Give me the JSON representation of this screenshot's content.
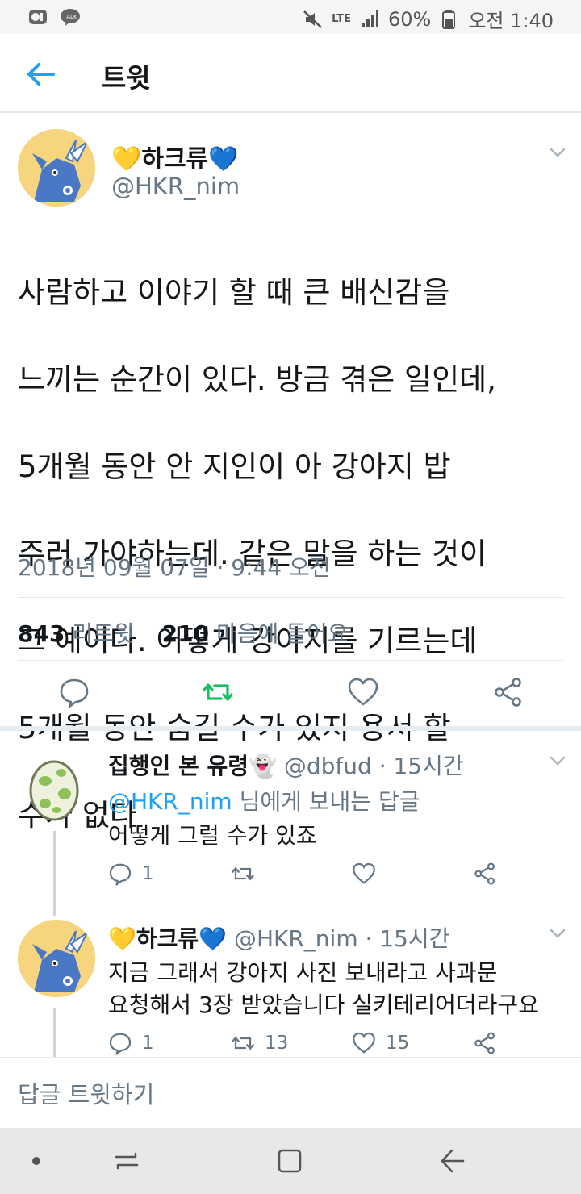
{
  "status_bar": {
    "left_icons": [
      "uplus-icon",
      "kakaotalk-icon"
    ],
    "kakao_label": "TALK",
    "network": "LTE",
    "battery": "60%",
    "time": "오전 1:40"
  },
  "header": {
    "title": "트윗"
  },
  "tweet": {
    "name": "하크류",
    "name_emoji_left": "💛",
    "name_emoji_right": "💙",
    "handle": "@HKR_nim",
    "lines": [
      "사람하고 이야기 할 때 큰 배신감을",
      "느끼는 순간이 있다. 방금 겪은 일인데,",
      "5개월 동안 안 지인이 아 강아지 밥",
      "주러 가야하는데. 같은 말을 하는 것이",
      "그 예이다. 어떻게 강아지를 기르는데",
      "5개월 동안 숨길 수가 있지 용서 할",
      "수가 없다"
    ],
    "timestamp": "2018년 09월 07일 · 9:44 오전",
    "retweets_count": "843",
    "retweets_label": "리트윗",
    "likes_count": "210",
    "likes_label": "마음에 들어요"
  },
  "replies": [
    {
      "name": "집행인 본 유령",
      "name_emoji": "👻",
      "handle": "@dbfud",
      "time": "· 15시간",
      "mention_handle": "@HKR_nim",
      "mention_suffix": "님에게 보내는 답글",
      "text_lines": [
        "어떻게 그럴 수가 있죠"
      ],
      "reply_count": "1",
      "retweet_count": "",
      "like_count": ""
    },
    {
      "name": "하크류",
      "name_emoji_left": "💛",
      "name_emoji_right": "💙",
      "handle": "@HKR_nim",
      "time": "· 15시간",
      "text_lines": [
        "지금 그래서 강아지 사진 보내라고 사과문",
        "요청해서 3장 받았습니다 실키테리어더라구요"
      ],
      "reply_count": "1",
      "retweet_count": "13",
      "like_count": "15"
    }
  ],
  "composer": {
    "placeholder": "답글 트윗하기"
  },
  "colors": {
    "accent": "#1da1f2",
    "retweet_green": "#17bf63",
    "secondary_text": "#657786",
    "avatar_bg": "#f6d57e"
  }
}
